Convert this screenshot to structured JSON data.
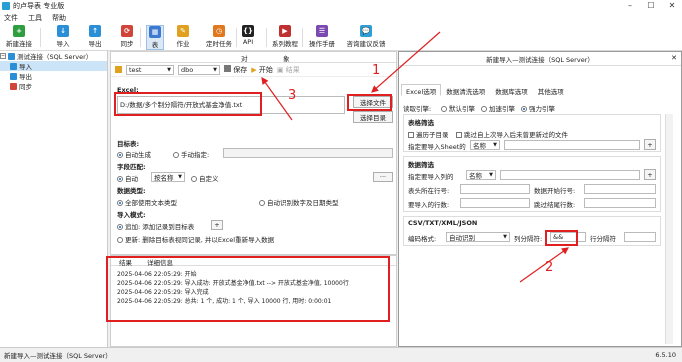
{
  "window": {
    "title": "的卢导表 专业版"
  },
  "menu": [
    "文件",
    "工具",
    "帮助"
  ],
  "toolbar": [
    {
      "label": "新建连接",
      "icon": "new-connection-icon",
      "color": "#2e9e3f"
    },
    {
      "label": "导入",
      "icon": "import-icon",
      "color": "#2a8fd6"
    },
    {
      "label": "导出",
      "icon": "export-icon",
      "color": "#2a8fd6"
    },
    {
      "label": "同步",
      "icon": "sync-icon",
      "color": "#d0443a"
    },
    {
      "label": "表",
      "icon": "table-icon",
      "color": "#3b7ad0"
    },
    {
      "label": "作业",
      "icon": "job-icon",
      "color": "#e0a020"
    },
    {
      "label": "定时任务",
      "icon": "scheduled-task-icon",
      "color": "#e07820"
    },
    {
      "label": "API",
      "icon": "api-icon",
      "color": "#222222"
    },
    {
      "label": "系列教程",
      "icon": "tutorial-icon",
      "color": "#c03030"
    },
    {
      "label": "操作手册",
      "icon": "manual-icon",
      "color": "#7a4ab0"
    },
    {
      "label": "咨询建议反馈",
      "icon": "feedback-icon",
      "color": "#2e9ed6"
    }
  ],
  "tree": {
    "root": "测试连接（SQL Server）",
    "items": [
      "导入",
      "导出",
      "同步"
    ]
  },
  "panel": {
    "tabs": [
      "对",
      "象"
    ],
    "db": "test",
    "schema": "dbo",
    "save": "保存",
    "start": "开始",
    "finish": "结果",
    "excel_label": "Excel:",
    "excel_path": "D:/数据/多个制分隔符/开放式基金净值.txt",
    "btn_select_file": "选择文件",
    "btn_select_dir": "选择目录",
    "target_label": "目标表:",
    "target_auto": "自动生成",
    "target_manual": "手动指定:",
    "field_match_label": "字段匹配:",
    "field_auto": "自动",
    "field_mode": "按名称",
    "field_custom": "自定义",
    "type_label": "数据类型:",
    "type_all_text": "全部使用文本类型",
    "type_auto": "自动识别数字及日期类型",
    "mode_label": "导入模式:",
    "mode_append": "追加: 添加记录到目标表",
    "mode_update": "更新: 删除目标表视同记录, 并以Excel重新导入数据"
  },
  "log": {
    "tabs": [
      "结果",
      "详细信息"
    ],
    "lines": [
      "2025-04-06 22:05:29: 开始",
      "2025-04-06 22:05:29: 导入成功: 开放式基金净值.txt --> 开放式基金净值, 10000行",
      "2025-04-06 22:05:29: 导入完成",
      "2025-04-06 22:05:29: 总共: 1 个, 成功: 1 个, 导入 10000 行, 用时: 0:00:01"
    ]
  },
  "dialog": {
    "title": "新建导入—测试连接（SQL Server）",
    "tabs": [
      "Excel选项",
      "数据清洗选项",
      "数据库选项",
      "其他选项"
    ],
    "engine_label": "读取引擎:",
    "engine_default": "默认引擎",
    "engine_fast": "加速引擎",
    "engine_strong": "强力引擎",
    "sheet_section": "表格筛选",
    "sheet_sub": "遍历子目录",
    "sheet_skip": "跳过自上次导入后未曾更新过的文件",
    "sheet_specify": "指定要导入Sheet的",
    "sheet_mode": "名称",
    "data_section": "数据筛选",
    "data_cols": "指定要导入列的",
    "data_cols_mode": "名称",
    "header_row": "表头所在行号:",
    "data_start": "数据开始行号:",
    "data_count": "要导入的行数:",
    "skip_tail": "跳过结尾行数:",
    "csv_section": "CSV/TXT/XML/JSON",
    "encoding_label": "编码格式:",
    "encoding_value": "自动识别",
    "col_sep_label": "列分隔符:",
    "col_sep_value": "&&",
    "row_sep_label": "行分隔符"
  },
  "annotations": [
    "1",
    "2",
    "3"
  ],
  "status": {
    "left": "新建导入—测试连接（SQL Server）",
    "version": "6.5.10"
  }
}
